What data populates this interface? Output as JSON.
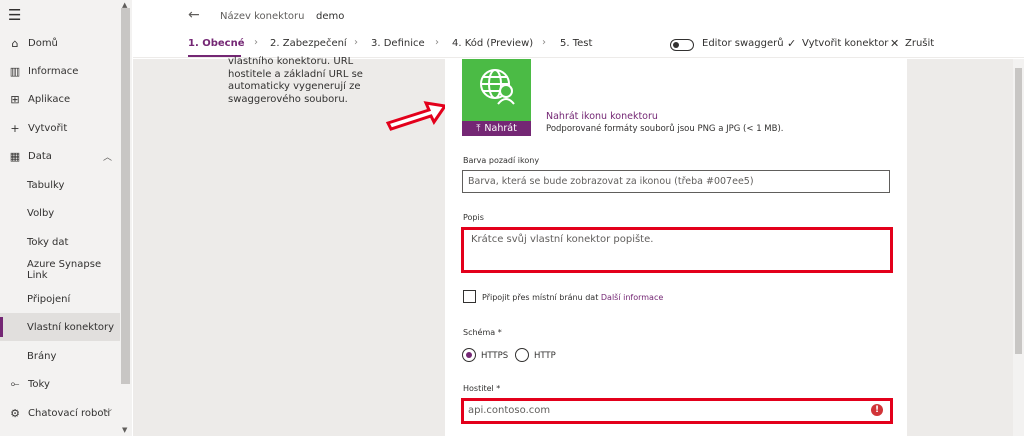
{
  "nav": {
    "items": [
      {
        "label": "Domů",
        "icon": "home-icon"
      },
      {
        "label": "Informace",
        "icon": "book-icon"
      },
      {
        "label": "Aplikace",
        "icon": "apps-icon"
      },
      {
        "label": "Vytvořit",
        "icon": "plus-icon"
      },
      {
        "label": "Data",
        "icon": "table-icon"
      },
      {
        "label": "Tabulky"
      },
      {
        "label": "Volby"
      },
      {
        "label": "Toky dat"
      },
      {
        "label": "Azure Synapse Link"
      },
      {
        "label": "Připojení"
      },
      {
        "label": "Vlastní konektory"
      },
      {
        "label": "Brány"
      },
      {
        "label": "Toky",
        "icon": "flow-icon"
      },
      {
        "label": "Chatovací roboti",
        "icon": "bot-icon"
      }
    ]
  },
  "header": {
    "connector_label": "Název konektoru",
    "connector_value": "demo"
  },
  "steps": [
    {
      "label": "1. Obecné"
    },
    {
      "label": "2. Zabezpečení"
    },
    {
      "label": "3. Definice"
    },
    {
      "label": "4. Kód (Preview)"
    },
    {
      "label": "5. Test"
    }
  ],
  "toolbar": {
    "swagger_label": "Editor swaggerů",
    "create_label": "Vytvořit konektor",
    "cancel_label": "Zrušit"
  },
  "description": "vlastního konektoru. URL hostitele a základní URL se automaticky vygenerují ze swaggerového souboru.",
  "icon_upload": {
    "button_label": "Nahrát",
    "link": "Nahrát ikonu konektoru",
    "hint": "Podporované formáty souborů jsou PNG a JPG (< 1 MB).",
    "tile_color": "#4bbb45"
  },
  "fields": {
    "bg_color_label": "Barva pozadí ikony",
    "bg_color_placeholder": "Barva, která se bude zobrazovat za ikonou (třeba #007ee5)",
    "desc_label": "Popis",
    "desc_placeholder": "Krátce svůj vlastní konektor popište.",
    "gateway_label": "Připojit přes místní bránu dat",
    "gateway_link": "Další informace",
    "schema_label": "Schéma *",
    "schema_options": [
      "HTTPS",
      "HTTP"
    ],
    "host_label": "Hostitel *",
    "host_value": "api.contoso.com"
  },
  "colors": {
    "accent": "#742774",
    "highlight": "#e3001b"
  }
}
